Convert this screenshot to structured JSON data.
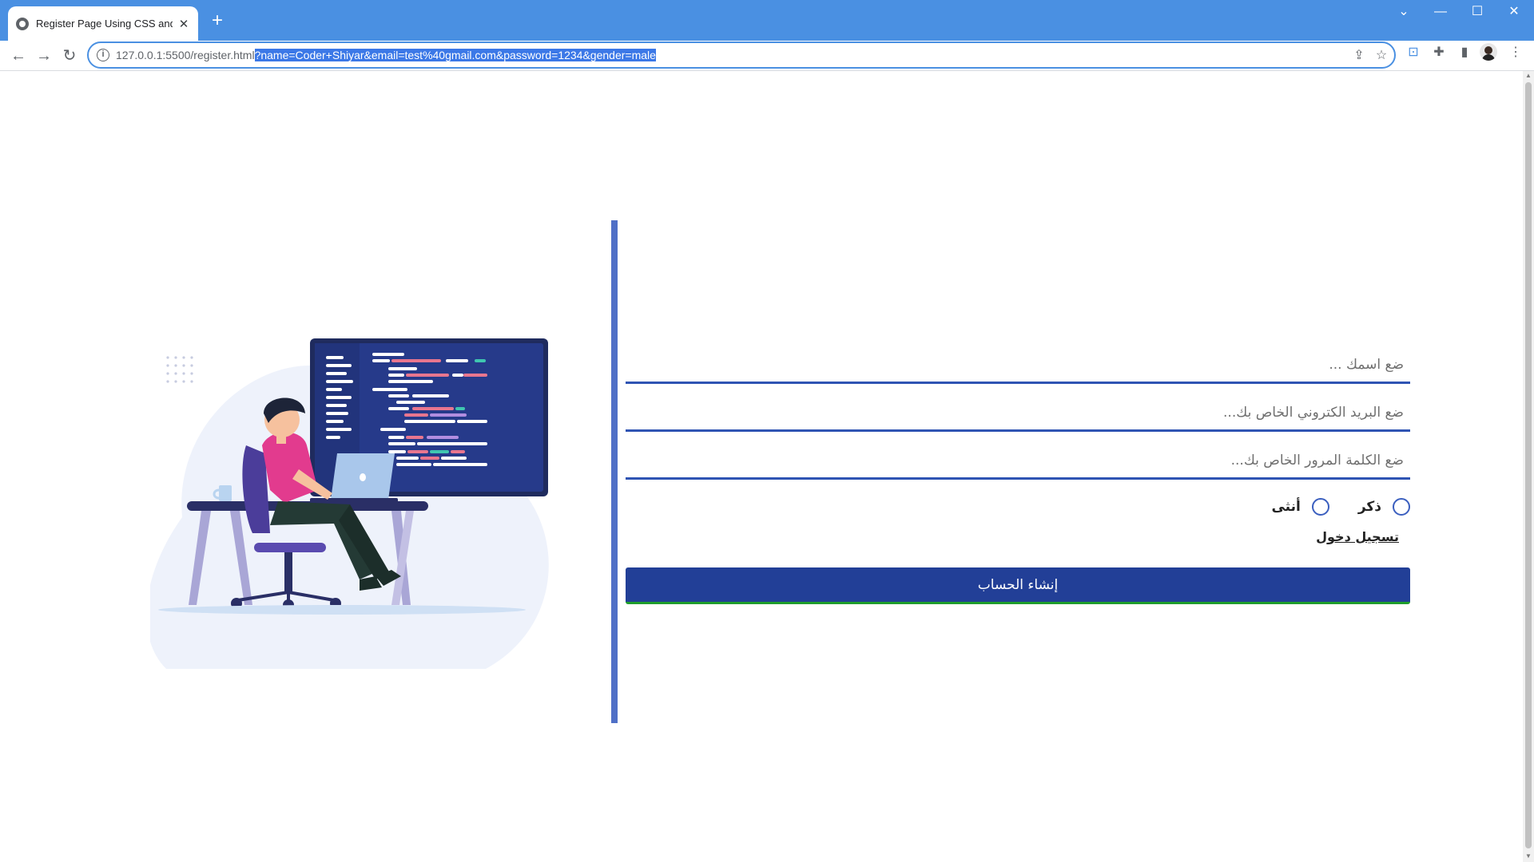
{
  "browser": {
    "tab_title": "Register Page Using CSS and HTML",
    "url_base": "127.0.0.1:5500/register.html",
    "url_query": "?name=Coder+Shiyar&email=test%40gmail.com&password=1234&gender=male"
  },
  "form": {
    "name_placeholder": "ضع اسمك ...",
    "email_placeholder": "ضع البريد الكتروني الخاص بك...",
    "password_placeholder": "ضع الكلمة المرور الخاص بك...",
    "gender_male": "ذكر",
    "gender_female": "أنثى",
    "login_link": "تسجيل دخول",
    "submit_label": "إنشاء الحساب"
  },
  "colors": {
    "accent": "#223f97",
    "field_border": "#2f54b3",
    "divider": "#4f6fc7",
    "tabbar": "#4a90e2"
  }
}
